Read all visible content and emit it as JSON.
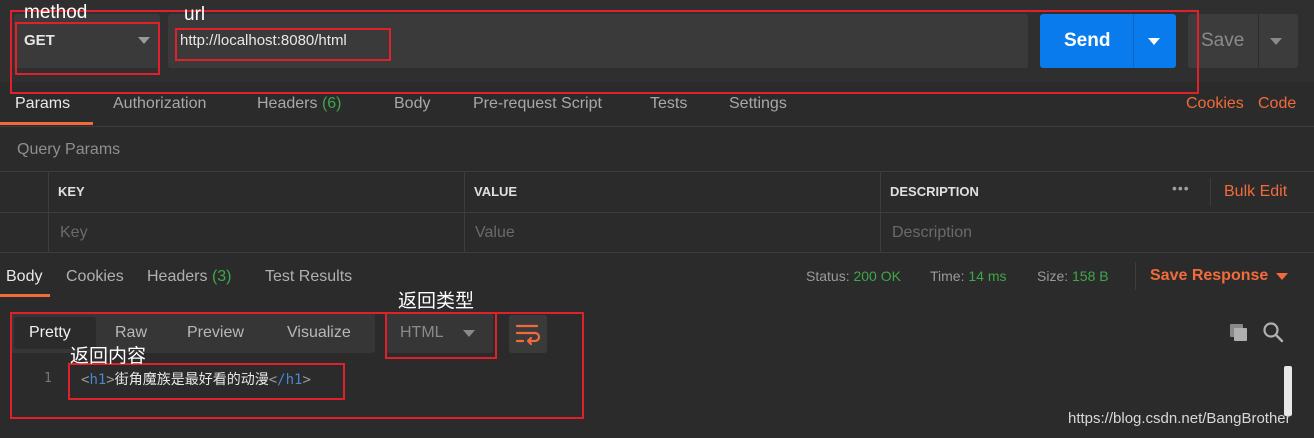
{
  "request": {
    "method": "GET",
    "url": "http://localhost:8080/html",
    "send_label": "Send",
    "save_label": "Save"
  },
  "annotations": {
    "method": "method",
    "url": "url",
    "return_type": "返回类型",
    "return_content": "返回内容"
  },
  "request_tabs": [
    {
      "label": "Params"
    },
    {
      "label": "Authorization"
    },
    {
      "label": "Headers",
      "count": "(6)"
    },
    {
      "label": "Body"
    },
    {
      "label": "Pre-request Script"
    },
    {
      "label": "Tests"
    },
    {
      "label": "Settings"
    }
  ],
  "links": {
    "cookies": "Cookies",
    "code": "Code"
  },
  "query_params": {
    "title": "Query Params",
    "columns": [
      "KEY",
      "VALUE",
      "DESCRIPTION"
    ],
    "placeholders": [
      "Key",
      "Value",
      "Description"
    ],
    "bulk_edit": "Bulk Edit",
    "more": "•••"
  },
  "response_tabs": [
    {
      "label": "Body"
    },
    {
      "label": "Cookies"
    },
    {
      "label": "Headers",
      "count": "(3)"
    },
    {
      "label": "Test Results"
    }
  ],
  "response_meta": {
    "status_label": "Status:",
    "status_value": "200 OK",
    "time_label": "Time:",
    "time_value": "14 ms",
    "size_label": "Size:",
    "size_value": "158 B",
    "save_response": "Save Response"
  },
  "view_tabs": [
    "Pretty",
    "Raw",
    "Preview",
    "Visualize"
  ],
  "format": "HTML",
  "code": {
    "line_number": "1",
    "open_tag": "h1",
    "content": "街角魔族是最好看的动漫",
    "close_tag": "/h1"
  },
  "watermark": "https://blog.csdn.net/BangBrother",
  "colors": {
    "accent": "#f26b3a",
    "send": "#097bed",
    "ok": "#3fa64a",
    "annotation": "#e0202a"
  }
}
